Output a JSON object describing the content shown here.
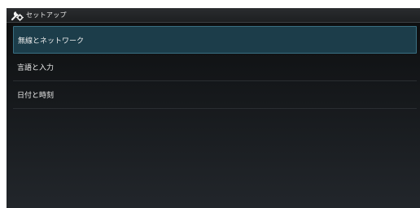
{
  "action_bar": {
    "icon": "settings-wrench-gear-icon",
    "title": "セットアップ"
  },
  "setup_menu": {
    "items": [
      {
        "label": "無線とネットワーク",
        "selected": true
      },
      {
        "label": "言語と入力",
        "selected": false
      },
      {
        "label": "日付と時刻",
        "selected": false
      }
    ]
  },
  "colors": {
    "selection_background": "#1c3d4a",
    "selection_border": "#3a6f82",
    "text": "#ececec"
  }
}
